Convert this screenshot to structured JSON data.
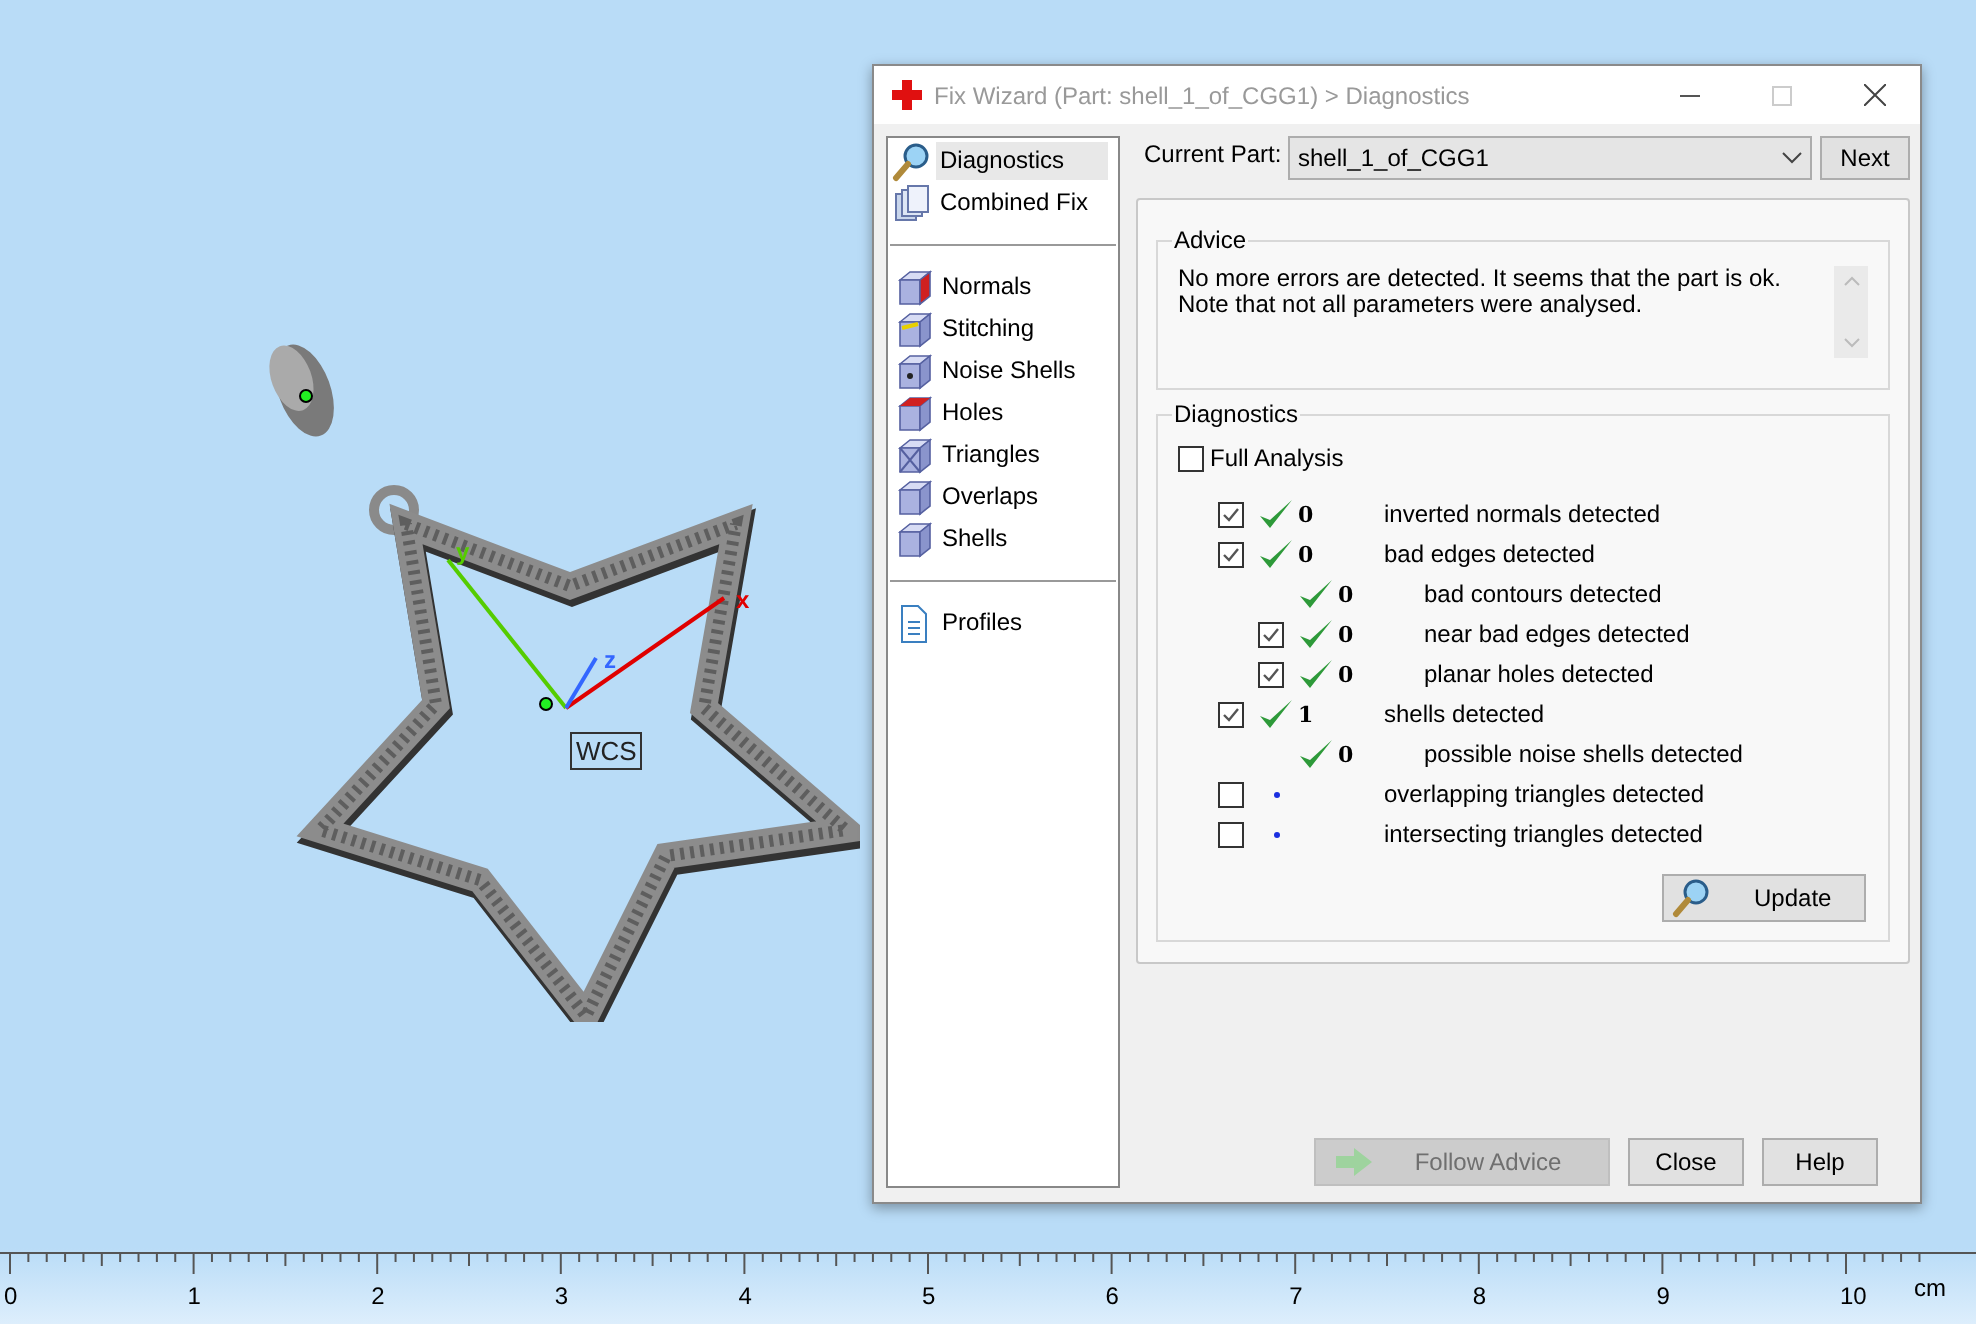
{
  "viewport": {
    "axis_labels": [
      {
        "text": "x",
        "color": "#e00000"
      },
      {
        "text": "y",
        "color": "#55cc00"
      },
      {
        "text": "z",
        "color": "#3366ff"
      }
    ],
    "frame_label": "WCS"
  },
  "window": {
    "title": "Fix Wizard (Part: shell_1_of_CGG1) > Diagnostics",
    "maximize_disabled": true
  },
  "sidebar": {
    "groups": [
      [
        {
          "label": "Diagnostics",
          "selected": true
        },
        {
          "label": "Combined Fix",
          "selected": false
        }
      ],
      [
        {
          "label": "Normals",
          "selected": false
        },
        {
          "label": "Stitching",
          "selected": false
        },
        {
          "label": "Noise Shells",
          "selected": false
        },
        {
          "label": "Holes",
          "selected": false
        },
        {
          "label": "Triangles",
          "selected": false
        },
        {
          "label": "Overlaps",
          "selected": false
        },
        {
          "label": "Shells",
          "selected": false
        }
      ],
      [
        {
          "label": "Profiles",
          "selected": false
        }
      ]
    ]
  },
  "current_part": {
    "label": "Current Part:",
    "value": "shell_1_of_CGG1"
  },
  "next_button": "Next",
  "advice": {
    "title": "Advice",
    "text": "No more errors are detected. It seems that the part is ok. Note that not all parameters were analysed."
  },
  "diagnostics": {
    "title": "Diagnostics",
    "full_analysis": {
      "label": "Full Analysis",
      "checked": false
    },
    "items": [
      {
        "kind": "ok",
        "checked": true,
        "count": "0",
        "label": "inverted normals detected"
      },
      {
        "kind": "ok",
        "checked": true,
        "count": "0",
        "label": "bad edges detected",
        "children": [
          {
            "kind": "ok",
            "count": "0",
            "label": "bad contours detected"
          },
          {
            "kind": "ok",
            "checked": true,
            "count": "0",
            "label": "near bad edges detected"
          },
          {
            "kind": "ok",
            "checked": true,
            "count": "0",
            "label": "planar holes detected"
          }
        ]
      },
      {
        "kind": "ok",
        "checked": true,
        "count": "1",
        "label": "shells detected",
        "children": [
          {
            "kind": "ok",
            "count": "0",
            "label": "possible noise shells detected"
          }
        ]
      },
      {
        "kind": "pending",
        "checked": false,
        "label": "overlapping triangles detected"
      },
      {
        "kind": "pending",
        "checked": false,
        "label": "intersecting triangles detected"
      }
    ],
    "update_button": "Update"
  },
  "buttons": [
    {
      "label": "Follow Advice",
      "disabled": true
    },
    {
      "label": "Close",
      "disabled": false
    },
    {
      "label": "Help",
      "disabled": false
    }
  ],
  "ruler": {
    "labels": [
      "0",
      "1",
      "2",
      "3",
      "4",
      "5",
      "6",
      "7",
      "8",
      "9",
      "10"
    ],
    "unit": "cm"
  }
}
